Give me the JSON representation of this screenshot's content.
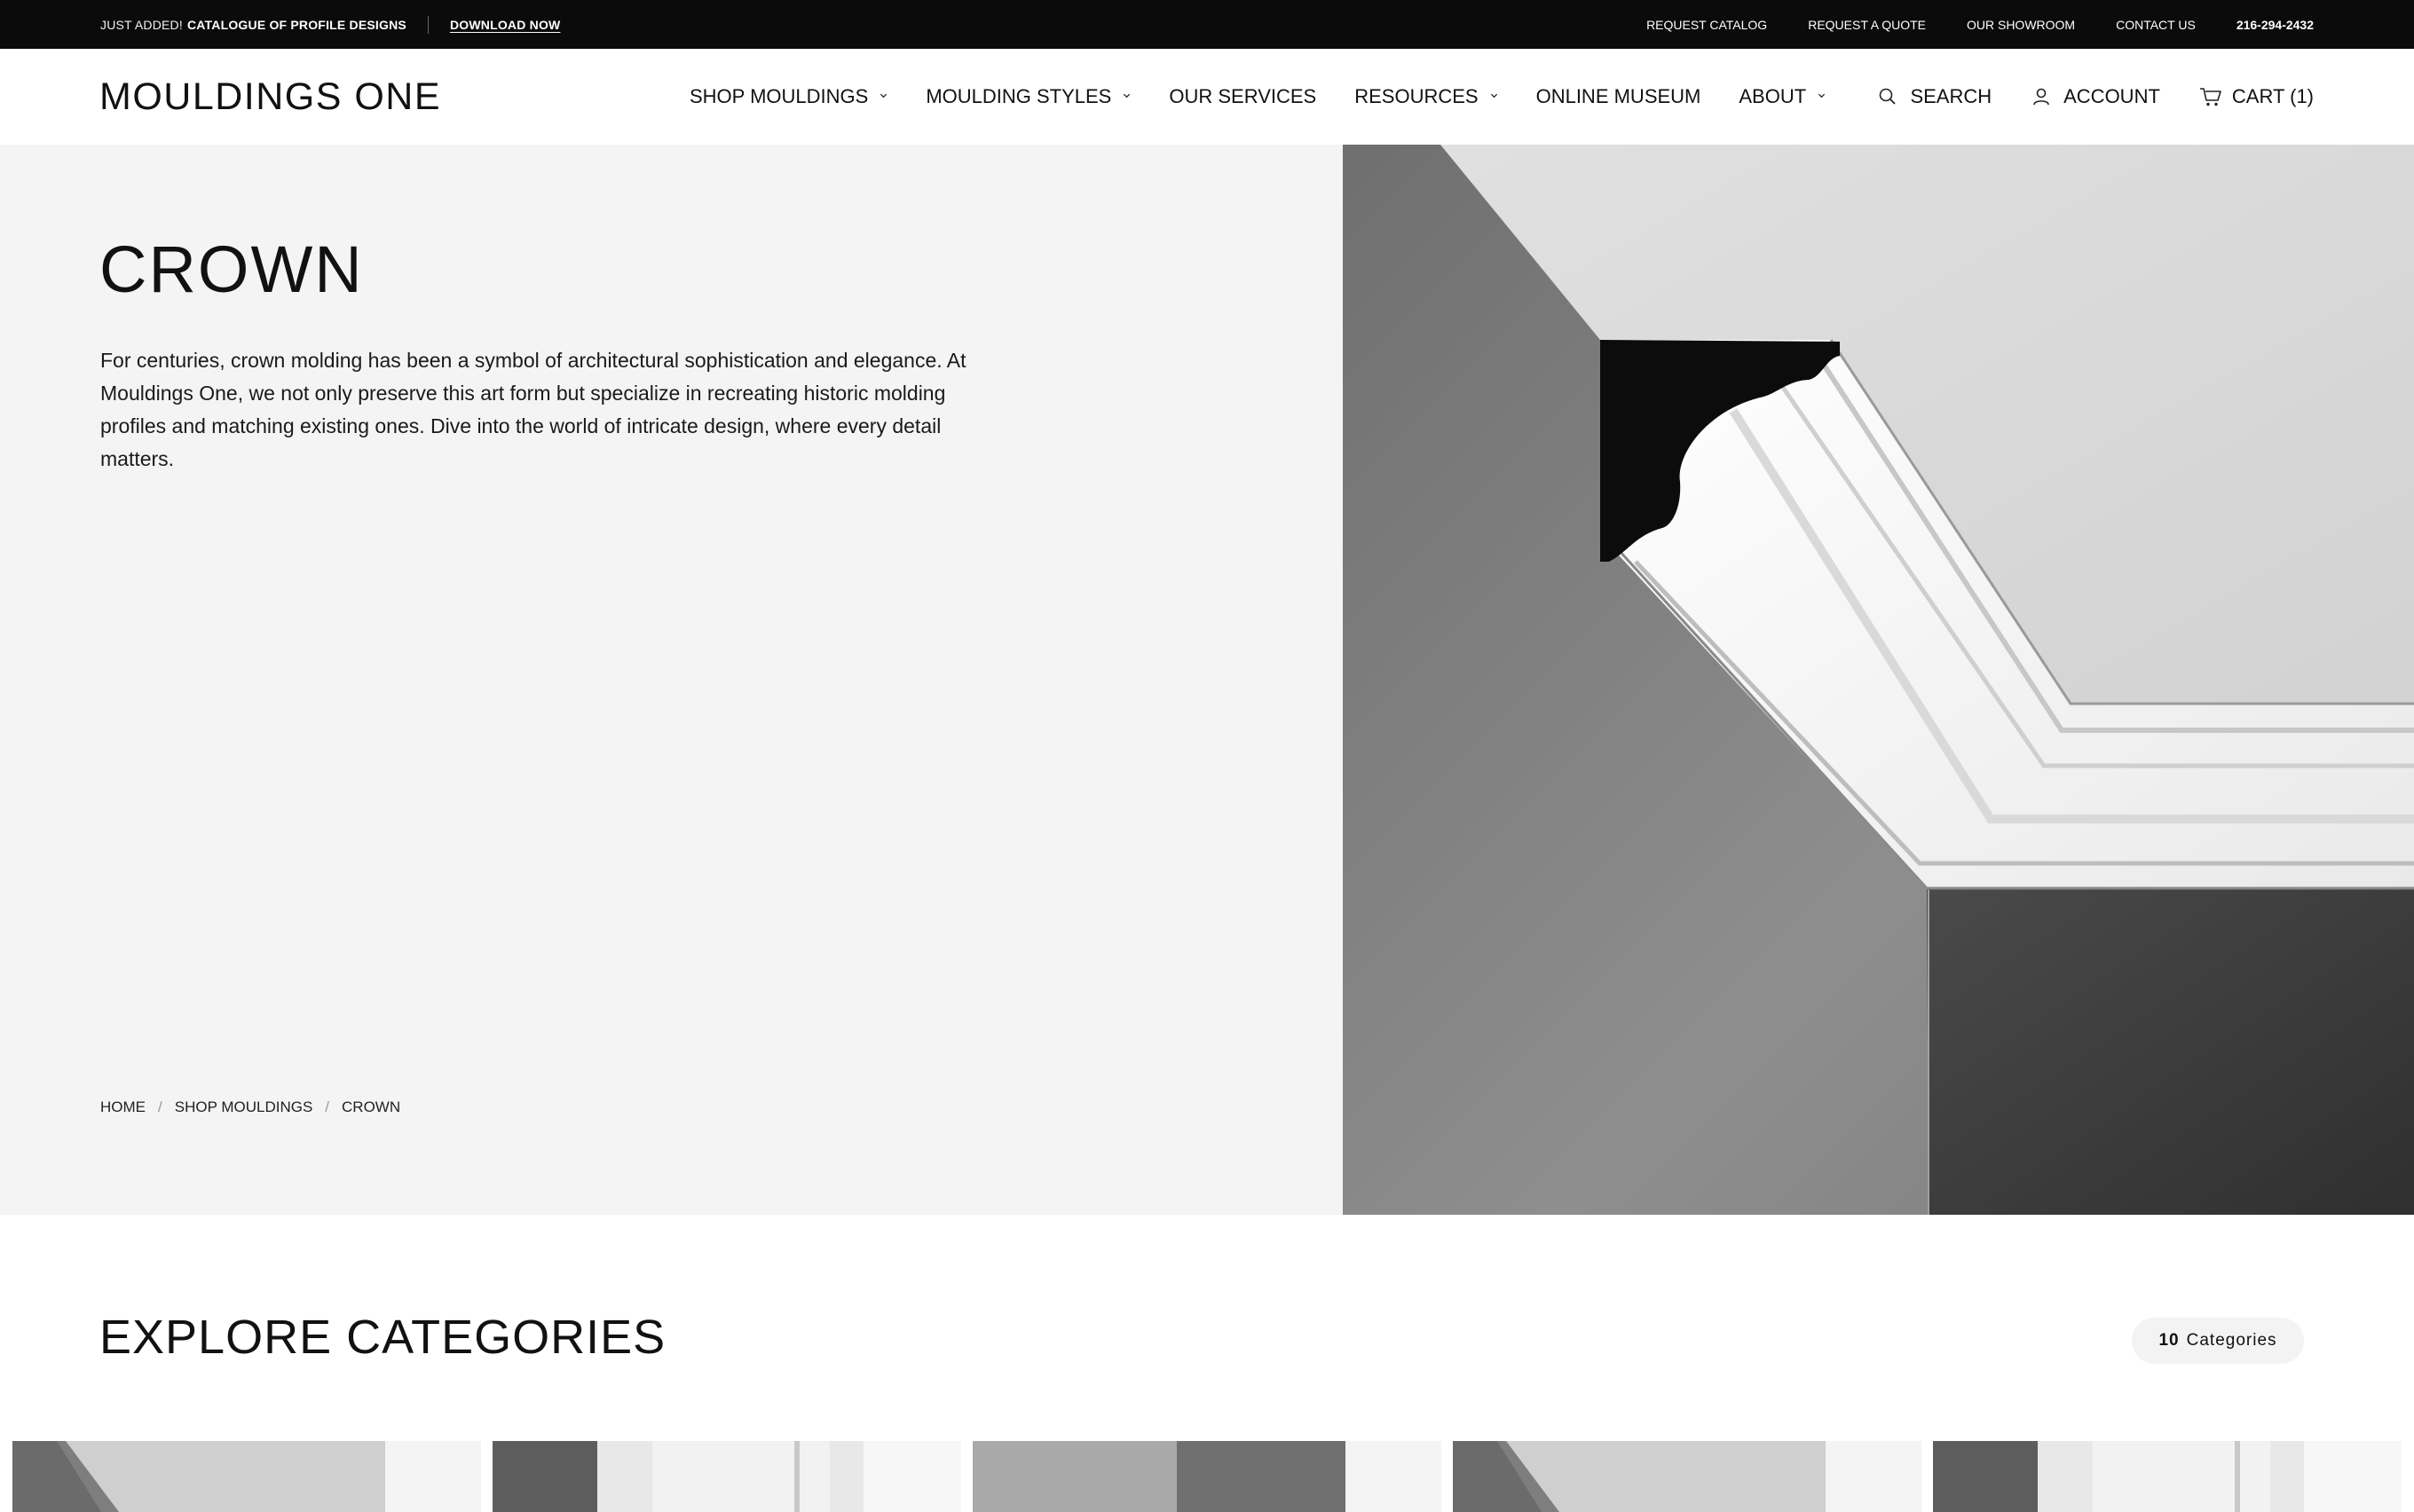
{
  "announcement": {
    "lead": "JUST ADDED!",
    "highlight": "CATALOGUE OF PROFILE DESIGNS",
    "cta": "DOWNLOAD NOW",
    "links": [
      "REQUEST CATALOG",
      "REQUEST A QUOTE",
      "OUR SHOWROOM",
      "CONTACT US"
    ],
    "phone": "216-294-2432"
  },
  "header": {
    "logo": "MOULDINGS ONE",
    "nav": [
      {
        "label": "SHOP MOULDINGS",
        "has_dropdown": true
      },
      {
        "label": "MOULDING STYLES",
        "has_dropdown": true
      },
      {
        "label": "OUR SERVICES",
        "has_dropdown": false
      },
      {
        "label": "RESOURCES",
        "has_dropdown": true
      },
      {
        "label": "ONLINE MUSEUM",
        "has_dropdown": false
      },
      {
        "label": "ABOUT",
        "has_dropdown": true
      }
    ],
    "search_label": "SEARCH",
    "account_label": "ACCOUNT",
    "cart_label": "CART (1)"
  },
  "hero": {
    "title": "CROWN",
    "description": "For centuries, crown molding has been a symbol of architectural sophistication and elegance. At Mouldings One, we not only preserve this art form but specialize in recreating historic molding profiles and matching existing ones. Dive into the world of intricate design, where every detail matters.",
    "breadcrumb": [
      "HOME",
      "SHOP MOULDINGS",
      "CROWN"
    ],
    "image": "crown-moulding-corner-photo"
  },
  "explore": {
    "title": "EXPLORE CATEGORIES",
    "count_number": "10",
    "count_label": "Categories",
    "cards": [
      {
        "image": "crown-corner-thumbnail"
      },
      {
        "image": "door-casing-thumbnail"
      },
      {
        "image": "wall-corner-thumbnail"
      },
      {
        "image": "crown-corner-thumbnail"
      },
      {
        "image": "door-casing-thumbnail"
      }
    ]
  },
  "colors": {
    "topbar_bg": "#0b0b0b",
    "hero_left_bg": "#f4f4f4",
    "text": "#111111",
    "pill_bg": "#f3f3f3"
  }
}
